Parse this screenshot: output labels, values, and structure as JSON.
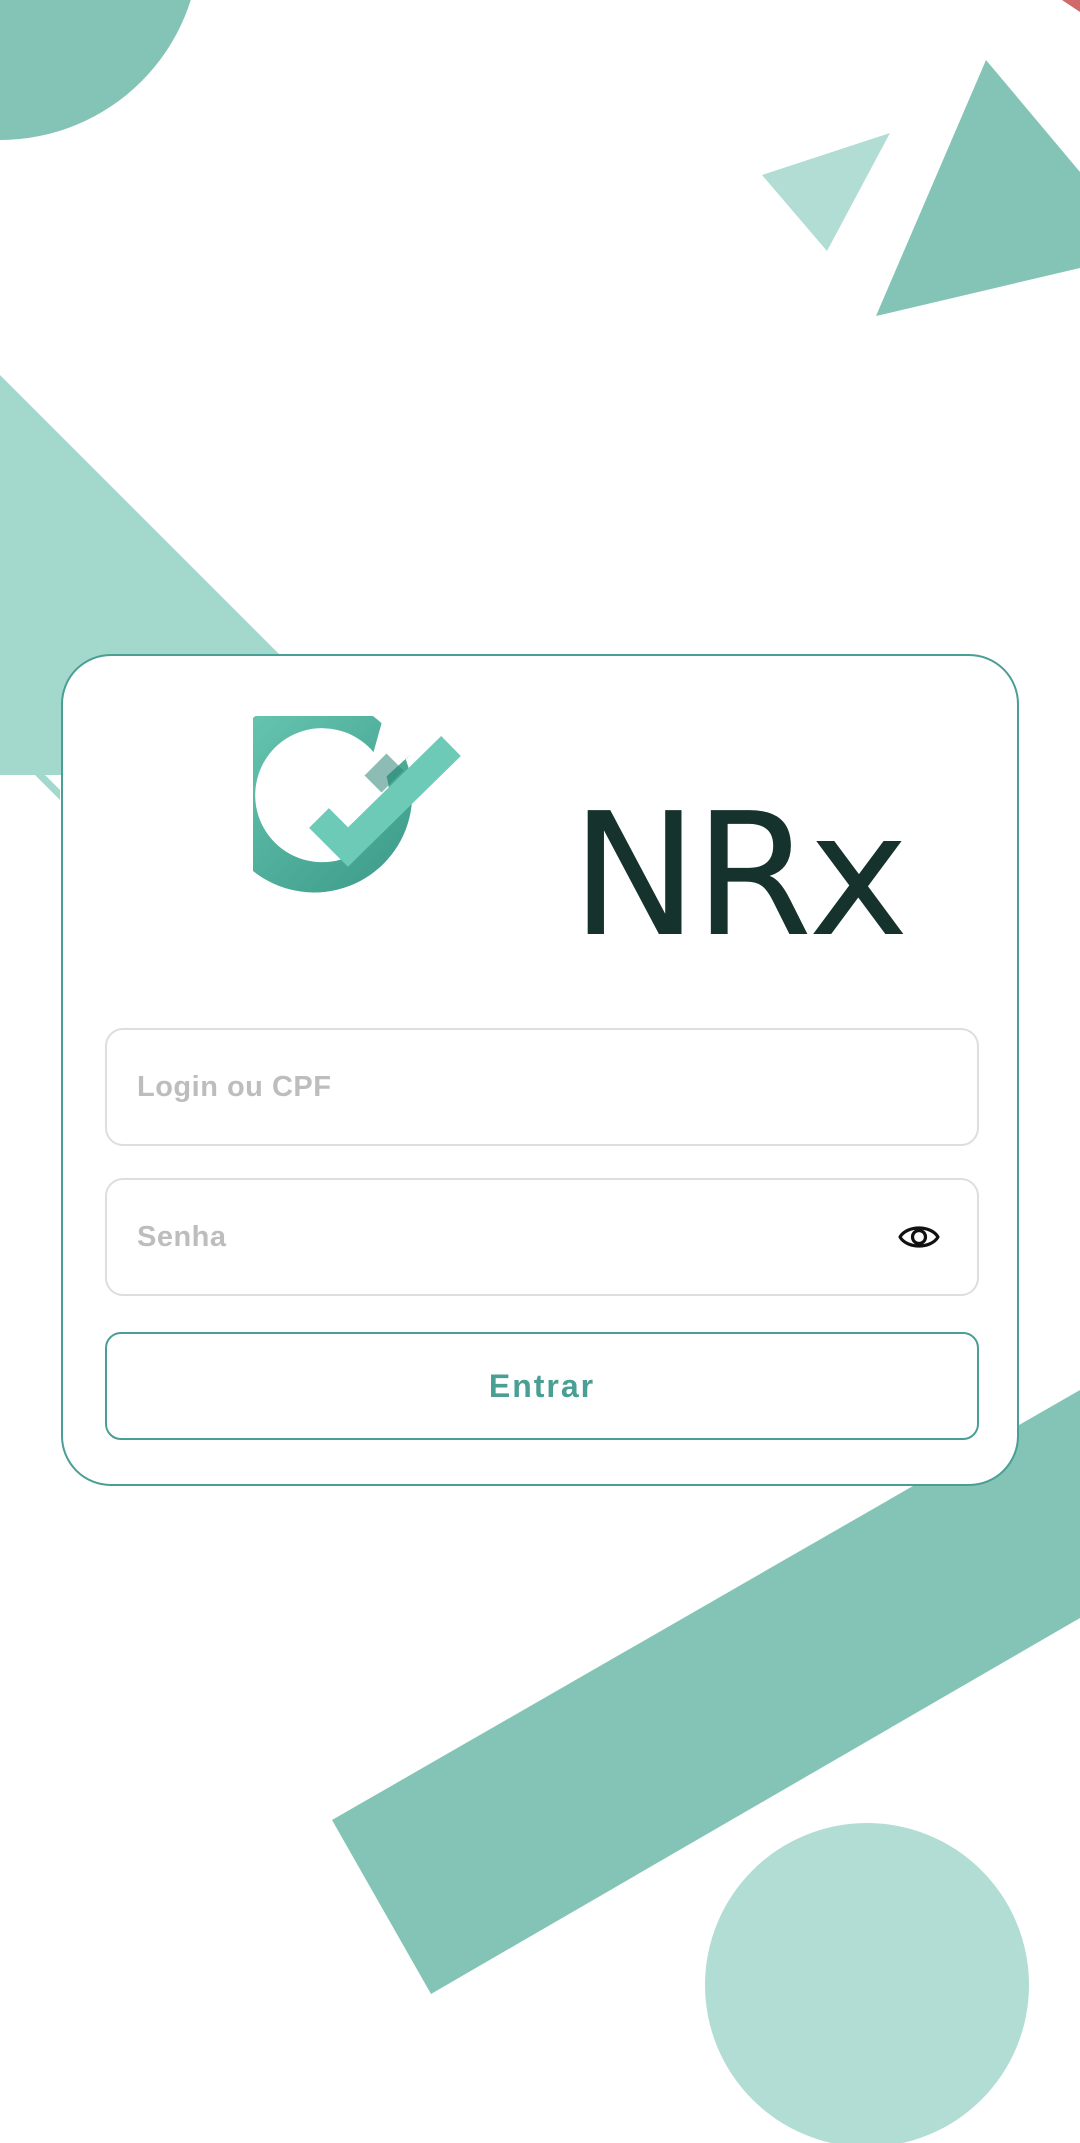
{
  "brand": {
    "name": "NRx"
  },
  "login_form": {
    "login_field": {
      "placeholder": "Login ou CPF",
      "value": ""
    },
    "password_field": {
      "placeholder": "Senha",
      "value": "",
      "toggle_icon": "eye-icon"
    },
    "submit_label": "Entrar"
  },
  "colors": {
    "accent": "#4a9f94",
    "shape_medium": "#84c4b7",
    "shape_light": "#a3d9cc",
    "shape_lighter": "#b1ddd4",
    "logo_light": "#6ccab6",
    "logo_dark": "#3a9a87",
    "brand_text": "#15322c",
    "corner_accent": "#d06a6a"
  }
}
